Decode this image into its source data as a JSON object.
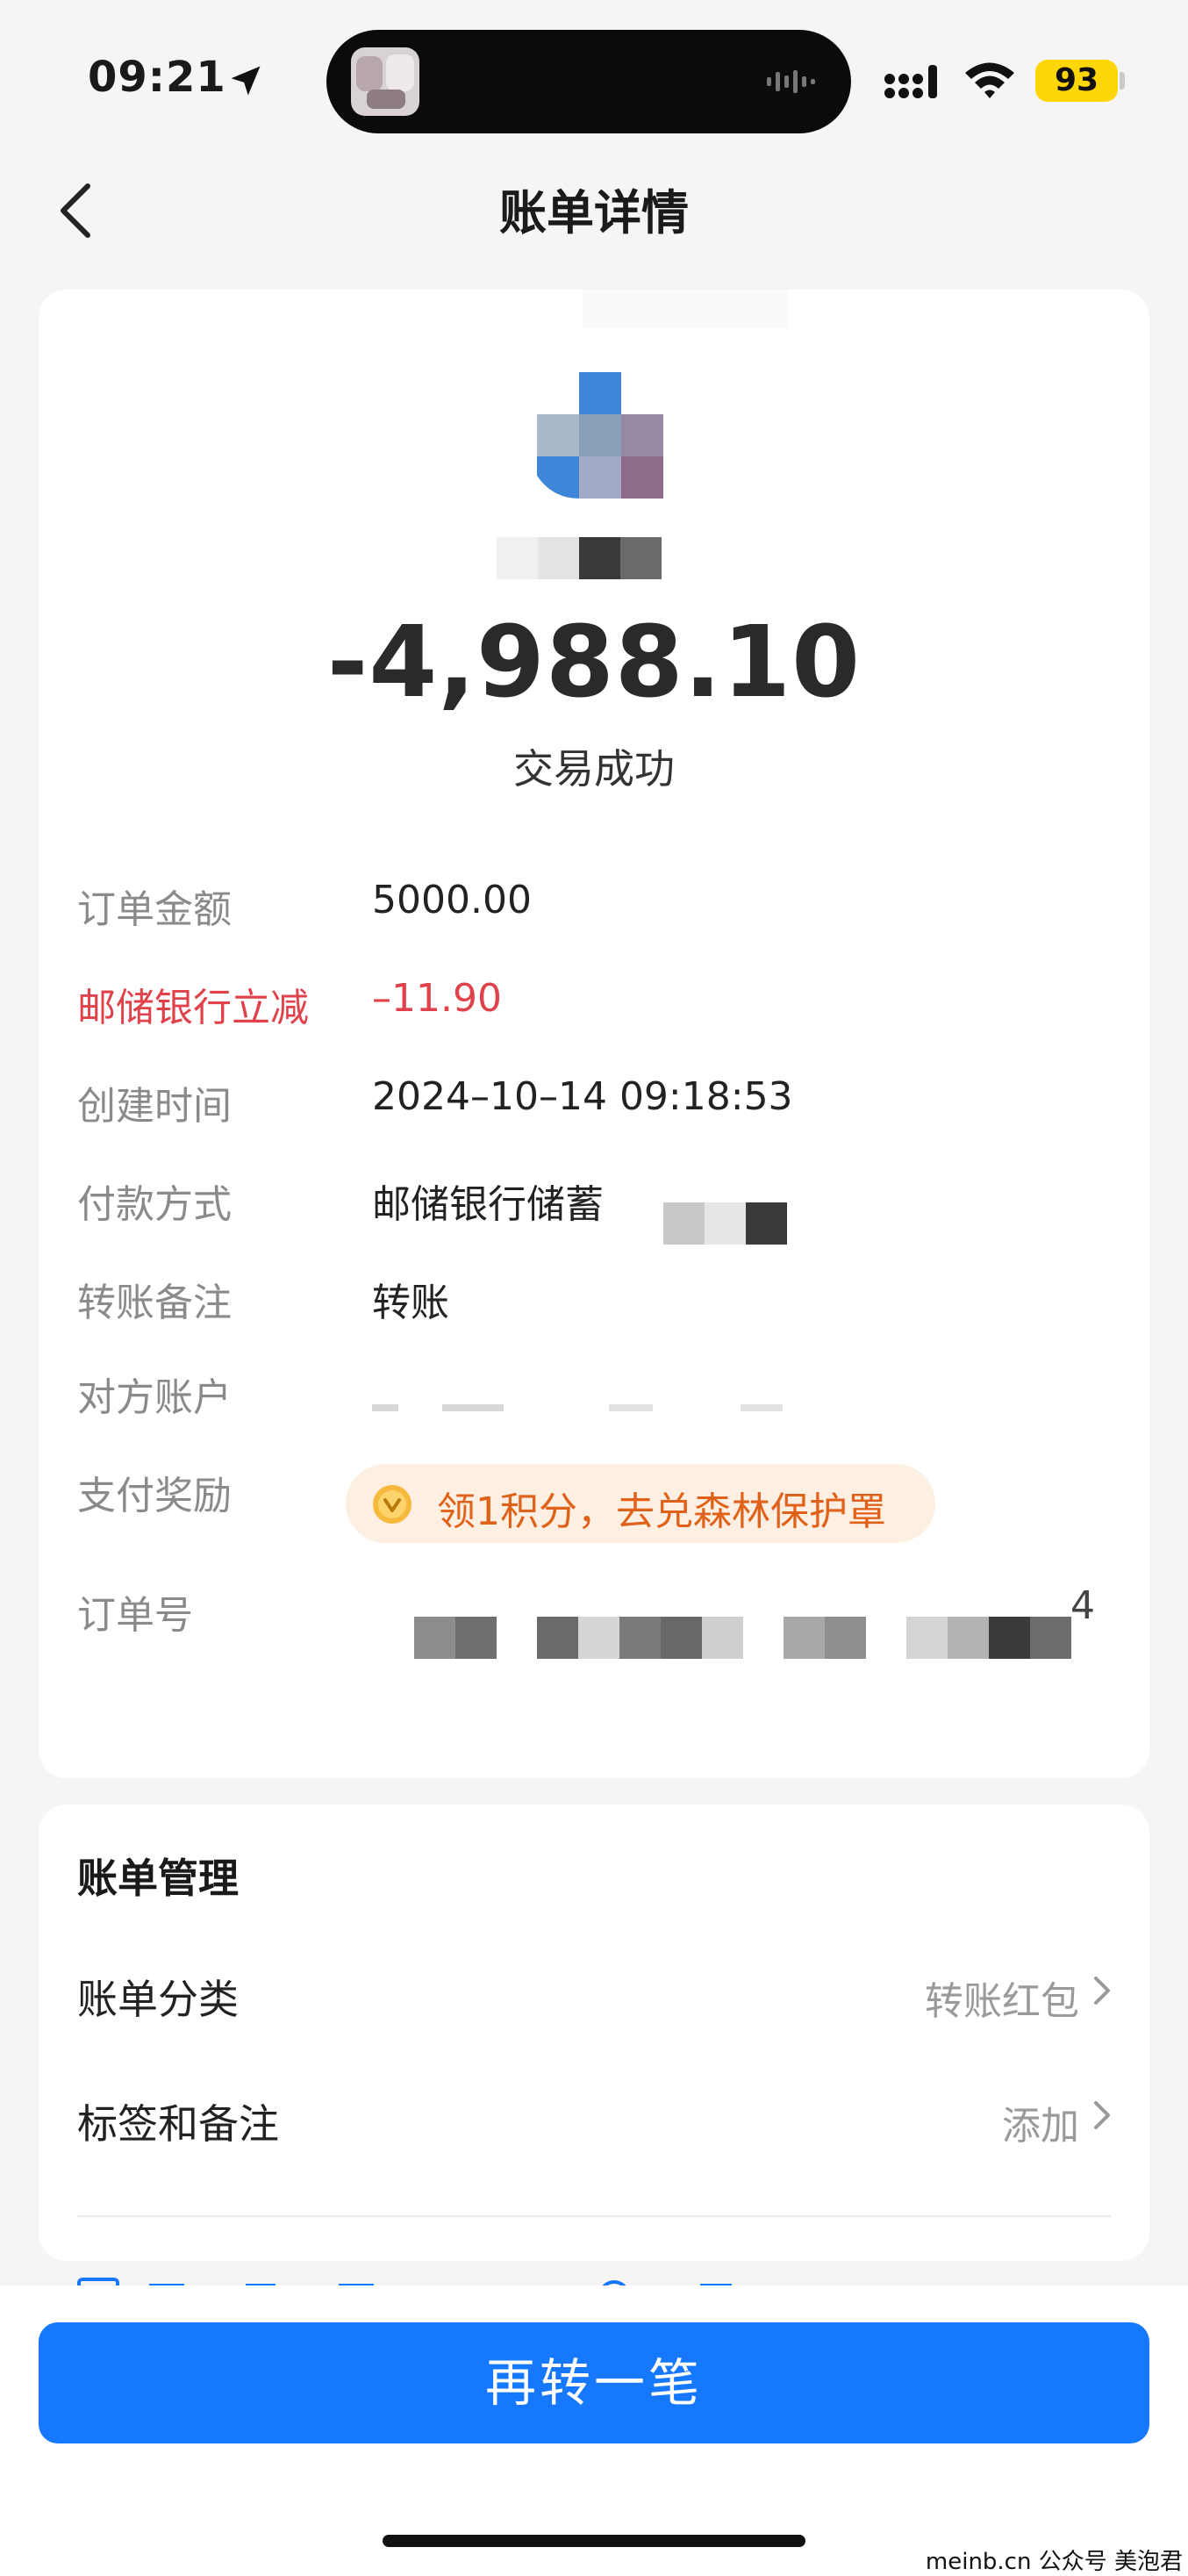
{
  "status_bar": {
    "time": "09:21",
    "battery": "93",
    "icons": [
      "location-arrow-icon",
      "signal-icon",
      "wifi-icon",
      "battery-icon"
    ],
    "battery_color": "#ffd60a"
  },
  "nav": {
    "title": "账单详情",
    "back_icon": "chevron-left-icon"
  },
  "transaction": {
    "amount": "-4,988.10",
    "status": "交易成功"
  },
  "details": {
    "order_amount": {
      "label": "订单金额",
      "value": "5000.00"
    },
    "discount": {
      "label": "邮储银行立减",
      "value": "–11.90"
    },
    "created_time": {
      "label": "创建时间",
      "value": "2024–10–14 09:18:53"
    },
    "payment_method": {
      "label": "付款方式",
      "value": "邮储银行储蓄"
    },
    "remark": {
      "label": "转账备注",
      "value": "转账"
    },
    "counterparty": {
      "label": "对方账户"
    },
    "reward": {
      "label": "支付奖励",
      "value": "领1积分，去兑森林保护罩"
    },
    "order_no": {
      "label": "订单号",
      "value_tail": "4"
    }
  },
  "bill_management": {
    "title": "账单管理",
    "category": {
      "label": "账单分类",
      "value": "转账红包"
    },
    "tags": {
      "label": "标签和备注",
      "value": "添加"
    }
  },
  "actions": {
    "primary": "再转一笔"
  },
  "watermark": "meinb.cn 公众号 美泡君",
  "colors": {
    "accent_blue": "#1677ff",
    "discount_red": "#e0424c",
    "reward_orange": "#e0621a",
    "reward_bg": "#fdf0e2"
  }
}
